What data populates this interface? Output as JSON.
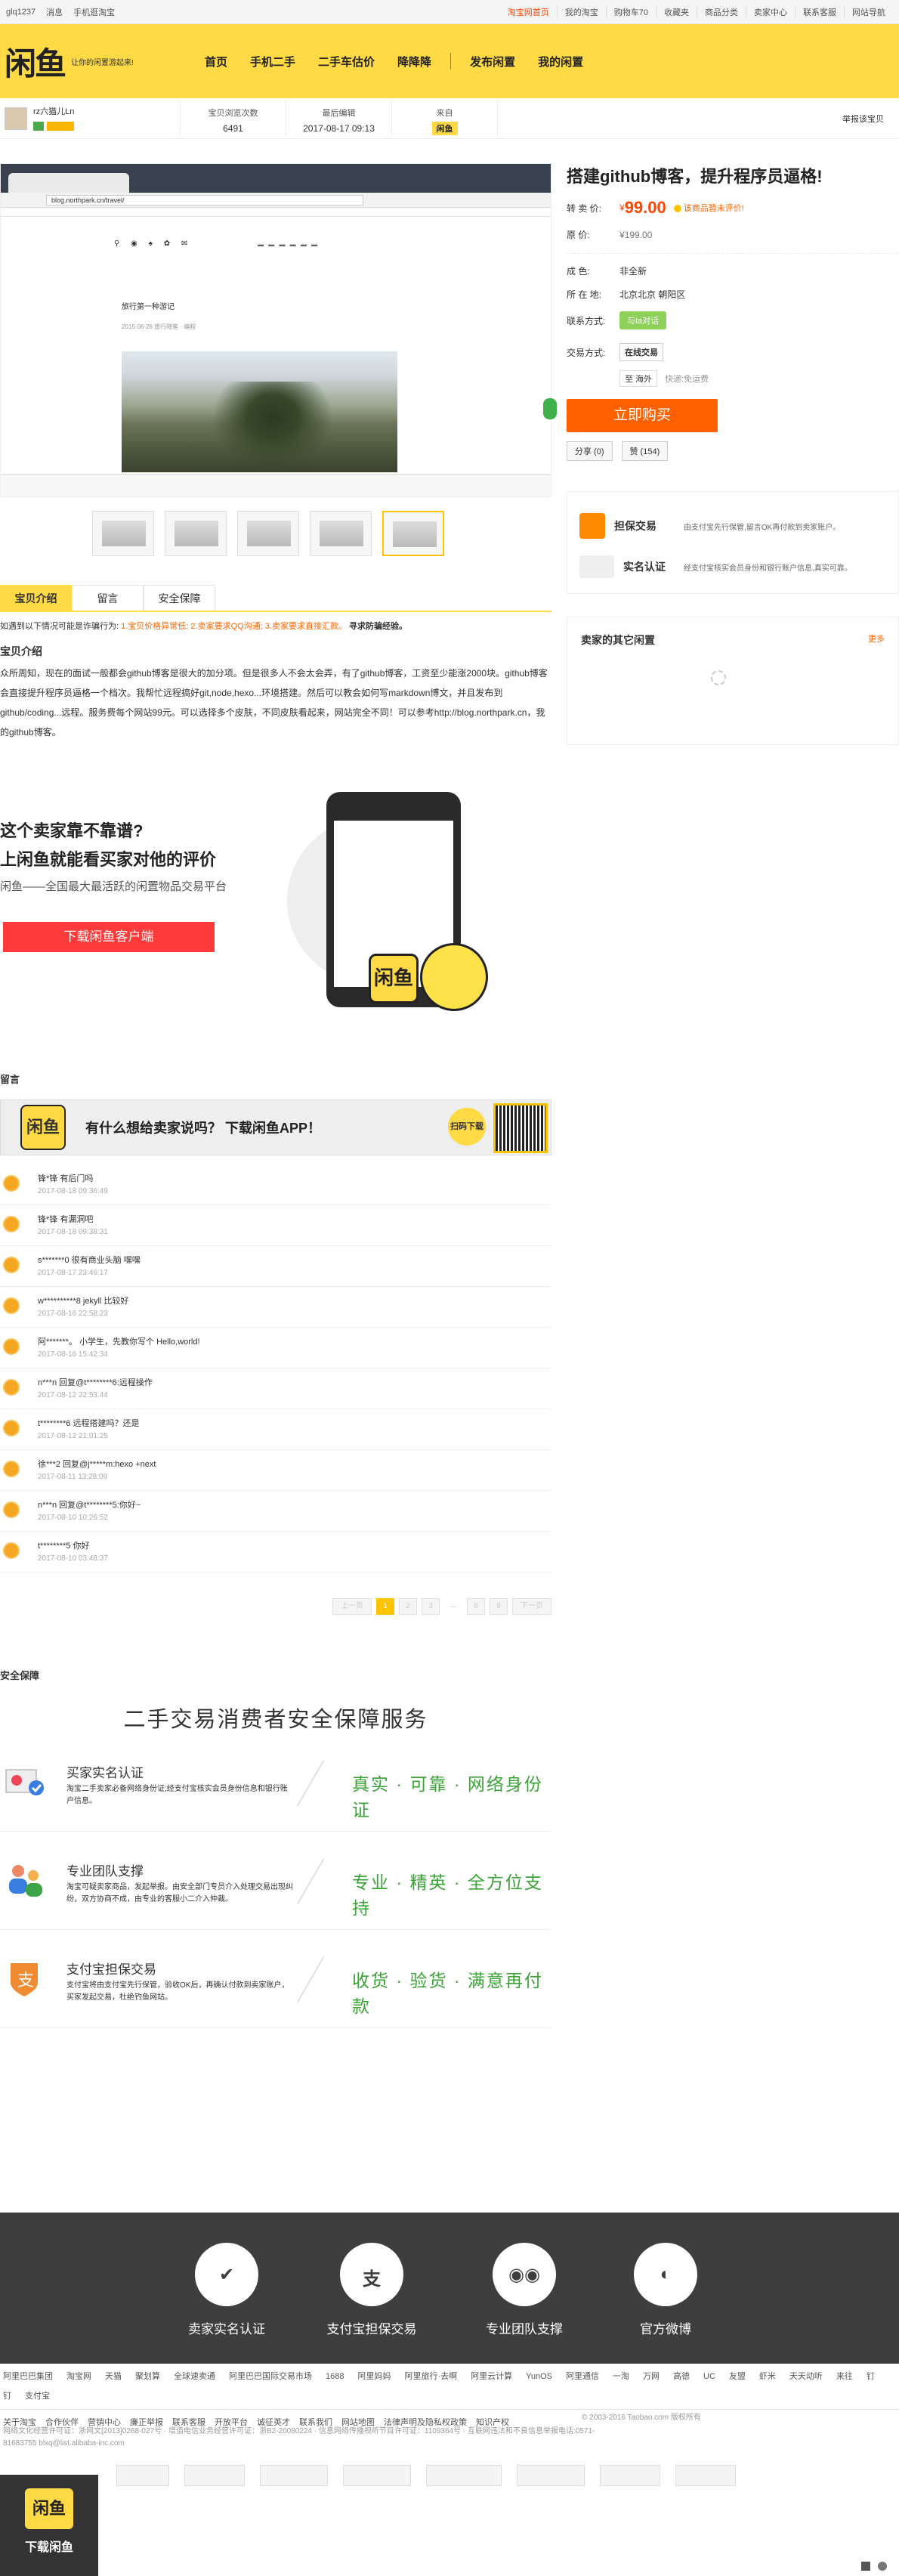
{
  "topbar": {
    "user": "glq1237",
    "messages": "消息",
    "mobile": "手机逛淘宝",
    "links": [
      "淘宝网首页",
      "我的淘宝",
      "购物车70",
      "收藏夹",
      "商品分类",
      "卖家中心",
      "联系客服",
      "网站导航"
    ]
  },
  "header": {
    "logo": "闲鱼",
    "slogan": "让你的闲置游起来!",
    "nav": [
      "首页",
      "手机二手",
      "二手车估价",
      "降降降",
      "发布闲置",
      "我的闲置"
    ]
  },
  "seller": {
    "name": "rz六猫儿Ln",
    "stats": [
      {
        "label": "宝贝浏览次数",
        "value": "6491"
      },
      {
        "label": "最后编辑",
        "value": "2017-08-17 09:13"
      },
      {
        "label": "来自",
        "value": "闲鱼"
      }
    ],
    "report": "举报该宝贝"
  },
  "screenshot": {
    "url": "blog.northpark.cn/travel/",
    "post_title": "旅行第一种游记",
    "post_date": "2015-06-26 旅行随笔 · 编程"
  },
  "product": {
    "title": "搭建github博客，提升程序员逼格!",
    "price_label": "转 卖 价:",
    "price": "99.00",
    "price_hint": "该商品暂未评价!",
    "orig_label": "原    价:",
    "orig_price": "199.00",
    "condition_label": "成    色:",
    "condition": "非全新",
    "location_label": "所 在 地:",
    "location": "北京北京 朝阳区",
    "contact_label": "联系方式:",
    "contact": "与ta对话",
    "trade_label": "交易方式:",
    "trade": "在线交易",
    "delivery": "至 海外",
    "delivery_note": "快递:免运费",
    "buy": "立即购买",
    "share": "分享 (0)",
    "like": "赞 (154)"
  },
  "guarantee": [
    {
      "title": "担保交易",
      "desc": "由支付宝先行保管,留言OK再付款到卖家账户。"
    },
    {
      "title": "实名认证",
      "desc": "经支付宝核实会员身份和银行账户信息,真实可靠。"
    }
  ],
  "other": {
    "title": "卖家的其它闲置",
    "more": "更多"
  },
  "tabs": [
    "宝贝介绍",
    "留言",
    "安全保障"
  ],
  "notice": {
    "text": "如遇到以下情况可能是诈骗行为:",
    "items": "1.宝贝价格异常低; 2.卖家要求QQ沟通; 3.卖家要求直接汇款。",
    "tail": "寻求防骗经验。"
  },
  "intro": {
    "title": "宝贝介绍",
    "text": "众所周知，现在的面试一般都会github博客是很大的加分项。但是很多人不会太会弄，有了github博客，工资至少能涨2000块。github博客会直接提升程序员逼格一个档次。我帮忙远程搞好git,node,hexo...环境搭建。然后可以教会如何写markdown博文，并且发布到github/coding...远程。服务费每个网站99元。可以选择多个皮肤，不同皮肤看起来，网站完全不同！可以参考http://blog.northpark.cn，我的github博客。"
  },
  "promo": {
    "line1": "这个卖家靠不靠谱?",
    "line2": "上闲鱼就能看买家对他的评价",
    "line3": "闲鱼——全国最大最活跃的闲置物品交易平台",
    "button": "下载闲鱼客户端"
  },
  "comments_title": "留言",
  "app_banner": {
    "text": "有什么想给卖家说吗？ 下载闲鱼APP！",
    "scan": "扫码下载"
  },
  "comments": [
    {
      "text": "锋*锋   有后门吗",
      "time": "2017-08-18 09:36:49"
    },
    {
      "text": "锋*锋   有漏洞吧",
      "time": "2017-08-18 09:38:31"
    },
    {
      "text": "s*******0   很有商业头脑 嘿嘿",
      "time": "2017-08-17 23:46:17"
    },
    {
      "text": "w**********8   jekyll 比较好",
      "time": "2017-08-16 22:58:23"
    },
    {
      "text": "阿*******。  小学生，先教你写个 Hello,world!",
      "time": "2017-08-16 15:42:34"
    },
    {
      "text": "n***n   回复@t********6:远程操作",
      "time": "2017-08-12 22:53:44"
    },
    {
      "text": "t********6   远程搭建吗？还是",
      "time": "2017-08-12 21:01:25"
    },
    {
      "text": "徐***2   回复@j*****m:hexo +next",
      "time": "2017-08-11 13:28:09"
    },
    {
      "text": "n***n   回复@t********5:你好~",
      "time": "2017-08-10 10:26:52"
    },
    {
      "text": "t********5   你好",
      "time": "2017-08-10 03:48:37"
    }
  ],
  "pager": [
    "上一页",
    "1",
    "2",
    "3",
    "...",
    "8",
    "9",
    "下一页"
  ],
  "safety": {
    "heading": "安全保障",
    "title": "二手交易消费者安全保障服务",
    "rows": [
      {
        "title": "买家实名认证",
        "desc": "淘宝二手卖家必备网络身份证;经支付宝核实会员身份信息和银行账户信息。",
        "kw": "真实 · 可靠 · 网络身份证"
      },
      {
        "title": "专业团队支撑",
        "desc": "淘宝可疑卖家商品，发起举报。由安全部门专员介入处理交易出现纠纷，双方协商不成，由专业的客服小二介入仲裁。",
        "kw": "专业 · 精英 · 全方位支持"
      },
      {
        "title": "支付宝担保交易",
        "desc": "支付宝将由支付宝先行保管，验收OK后，再确认付款到卖家账户，买家发起交易，杜绝钓鱼网站。",
        "kw": "收货 · 验货 · 满意再付款"
      }
    ]
  },
  "footer_icons": [
    "卖家实名认证",
    "支付宝担保交易",
    "专业团队支撑",
    "官方微博"
  ],
  "footer_links": [
    "阿里巴巴集团",
    "淘宝网",
    "天猫",
    "聚划算",
    "全球速卖通",
    "阿里巴巴国际交易市场",
    "1688",
    "阿里妈妈",
    "阿里旅行·去啊",
    "阿里云计算",
    "YunOS",
    "阿里通信",
    "一淘",
    "万网",
    "高德",
    "UC",
    "友盟",
    "虾米",
    "天天动听",
    "来往",
    "钉钉",
    "支付宝"
  ],
  "footer_links2": [
    "关于淘宝",
    "合作伙伴",
    "营销中心",
    "廉正举报",
    "联系客服",
    "开放平台",
    "诚征英才",
    "联系我们",
    "网站地图",
    "法律声明及隐私权政策",
    "知识产权"
  ],
  "copyright": "© 2003-2016 Taobao.com 版权所有",
  "license": "网络文化经营许可证：浙网文[2013]0268-027号 · 增值电信业务经营许可证：浙B2-20080224 · 信息网络传播视听节目许可证：1109364号 · 互联网违法和不良信息举报电话:0571-81683755 blxq@list.alibaba-inc.com",
  "download": {
    "logo": "闲鱼",
    "label": "下载闲鱼"
  }
}
